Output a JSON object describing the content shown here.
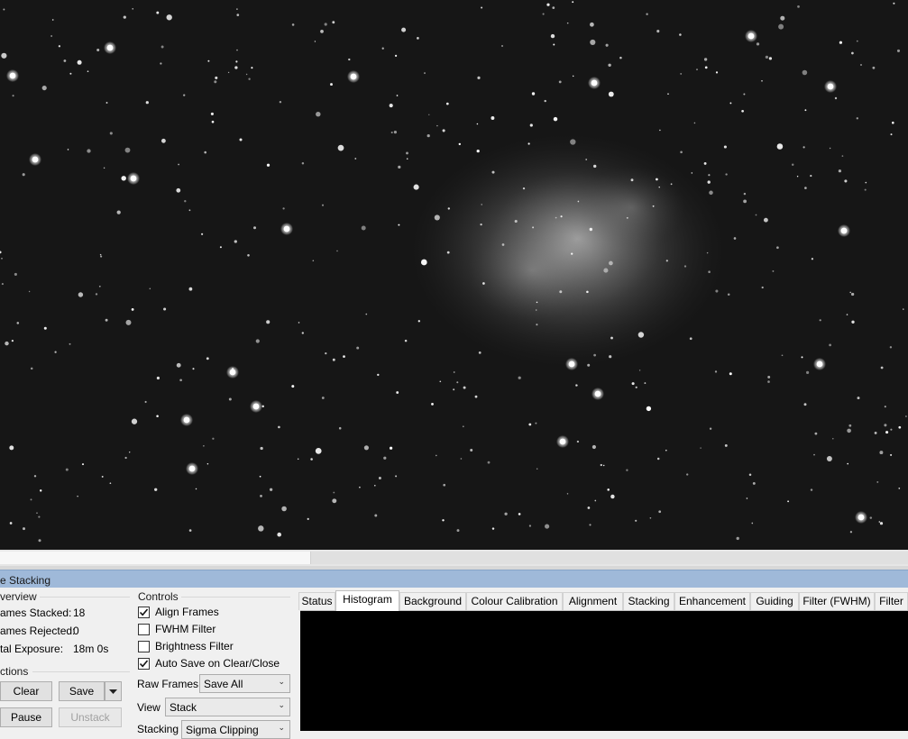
{
  "panel": {
    "title": "e Stacking"
  },
  "overview": {
    "heading": "verview",
    "frames_stacked_label": "ames Stacked:",
    "frames_stacked_value": "18",
    "frames_rejected_label": "ames Rejected:",
    "frames_rejected_value": "0",
    "total_exposure_label": "tal Exposure:",
    "total_exposure_value": "18m 0s"
  },
  "actions": {
    "heading": "ctions",
    "clear_label": "Clear",
    "save_label": "Save",
    "pause_label": "Pause",
    "unstack_label": "Unstack"
  },
  "controls": {
    "heading": "Controls",
    "checkboxes": [
      {
        "label": "Align Frames",
        "checked": true
      },
      {
        "label": "FWHM Filter",
        "checked": false
      },
      {
        "label": "Brightness Filter",
        "checked": false
      },
      {
        "label": "Auto Save on Clear/Close",
        "checked": true
      }
    ],
    "raw_frames_label": "Raw Frames",
    "raw_frames_value": "Save All",
    "view_label": "View",
    "view_value": "Stack",
    "stacking_label": "Stacking",
    "stacking_value": "Sigma Clipping"
  },
  "tabs": [
    {
      "label": "Status",
      "active": false
    },
    {
      "label": "Histogram",
      "active": true
    },
    {
      "label": "Background",
      "active": false
    },
    {
      "label": "Colour Calibration",
      "active": false
    },
    {
      "label": "Alignment",
      "active": false
    },
    {
      "label": "Stacking",
      "active": false
    },
    {
      "label": "Enhancement",
      "active": false
    },
    {
      "label": "Guiding",
      "active": false
    },
    {
      "label": "Filter (FWHM)",
      "active": false
    },
    {
      "label": "Filter",
      "active": false
    }
  ],
  "icons": {
    "check": "check-icon",
    "dropdown": "chevron-down-icon",
    "split_dropdown": "caret-down-icon"
  },
  "colors": {
    "sky": "#161616",
    "title_bar": "#9fb9d9",
    "histogram_bg": "#000000"
  }
}
